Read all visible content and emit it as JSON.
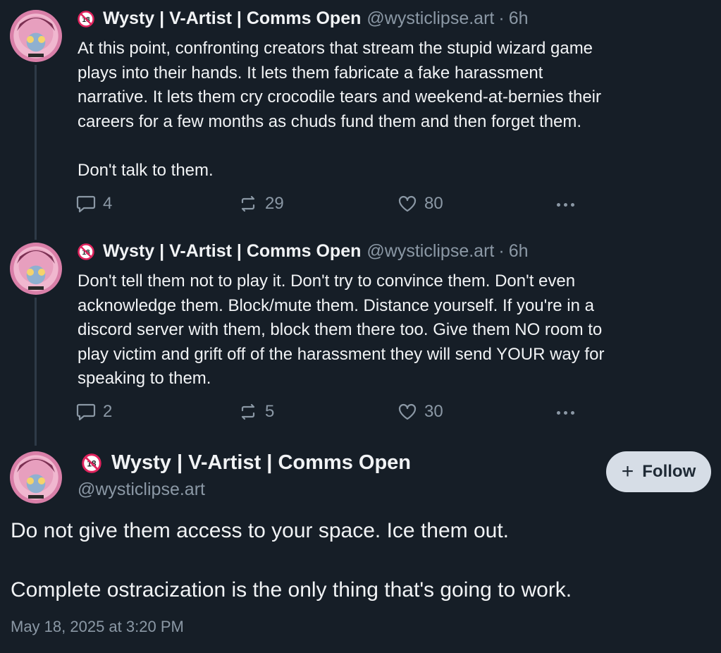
{
  "posts": [
    {
      "name": "Wysty | V-Artist | Comms Open",
      "handle": "@wysticlipse.art",
      "separator": "·",
      "time": "6h",
      "text": "At this point, confronting creators that stream the stupid wizard game\nplays into their hands. It lets them fabricate a fake harassment\nnarrative. It lets them cry crocodile tears and weekend-at-bernies their\ncareers for a few months as chuds fund them and then forget them.\n\nDon't talk to them.",
      "replies": "4",
      "reposts": "29",
      "likes": "80"
    },
    {
      "name": "Wysty | V-Artist | Comms Open",
      "handle": "@wysticlipse.art",
      "separator": "·",
      "time": "6h",
      "text": "Don't tell them not to play it. Don't try to convince them. Don't even\nacknowledge them. Block/mute them. Distance yourself. If you're in a\ndiscord server with them, block them there too. Give them NO room to\nplay victim and grift off of the harassment they will send YOUR way for\nspeaking to them.",
      "replies": "2",
      "reposts": "5",
      "likes": "30"
    }
  ],
  "main_post": {
    "name": "Wysty | V-Artist | Comms Open",
    "handle": "@wysticlipse.art",
    "follow_label": "Follow",
    "text": "Do not give them access to your space. Ice them out.\n\nComplete ostracization is the only thing that's going to work.",
    "timestamp": "May 18, 2025 at 3:20 PM"
  },
  "icons": {
    "nsfw": "no-under-18-icon",
    "reply": "speech-bubble-icon",
    "repost": "repost-arrows-icon",
    "like": "heart-icon",
    "more": "ellipsis-icon"
  },
  "colors": {
    "background": "#161e27",
    "text": "#f1f3f5",
    "muted": "#8b98a5",
    "follow_bg": "#d6dde6"
  }
}
